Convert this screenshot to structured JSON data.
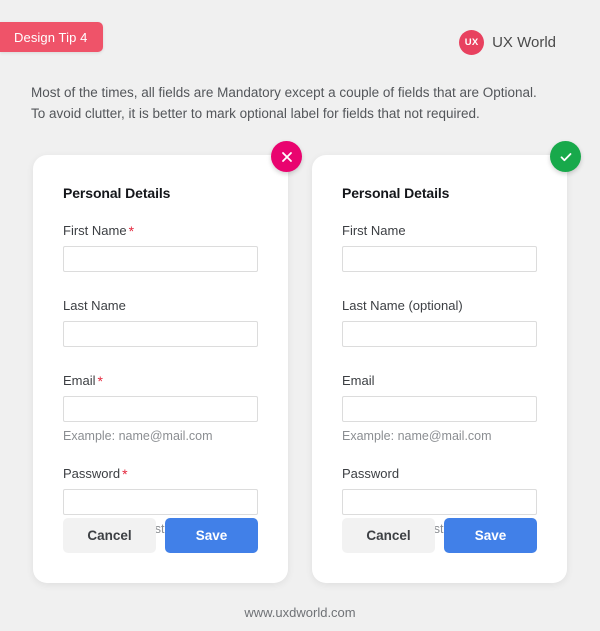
{
  "header": {
    "tip_badge": "Design Tip 4",
    "brand_mark": "UX",
    "brand_name": "UX World"
  },
  "intro": {
    "line1": "Most of the times, all fields are Mandatory except a couple of fields that are Optional.",
    "line2": "To avoid clutter, it is better to mark optional label for fields that not required."
  },
  "colors": {
    "background": "#f0f0f0",
    "tip_badge": "#ef5369",
    "brand_mark": "#e8415f",
    "bad_badge": "#e9046f",
    "good_badge": "#18a94b",
    "required_asterisk": "#e4273d",
    "save_button": "#4180e8",
    "cancel_button": "#f2f2f2",
    "card_background": "#ffffff",
    "input_border": "#dcdcdc"
  },
  "cards": [
    {
      "variant": "bad",
      "badge_icon": "close-icon",
      "title": "Personal Details",
      "fields": [
        {
          "label": "First Name",
          "required": true,
          "asterisk": "*",
          "hint": ""
        },
        {
          "label": "Last Name",
          "required": false,
          "asterisk": "",
          "hint": ""
        },
        {
          "label": "Email",
          "required": true,
          "asterisk": "*",
          "hint": "Example: name@mail.com"
        },
        {
          "label": "Password",
          "required": true,
          "asterisk": "*",
          "hint": "Must have at least 6 characters"
        }
      ],
      "cancel_label": "Cancel",
      "save_label": "Save"
    },
    {
      "variant": "good",
      "badge_icon": "check-icon",
      "title": "Personal Details",
      "fields": [
        {
          "label": "First Name",
          "required": false,
          "asterisk": "",
          "hint": ""
        },
        {
          "label": "Last Name (optional)",
          "required": false,
          "asterisk": "",
          "hint": ""
        },
        {
          "label": "Email",
          "required": false,
          "asterisk": "",
          "hint": "Example: name@mail.com"
        },
        {
          "label": "Password",
          "required": false,
          "asterisk": "",
          "hint": "Must have at least 6 characters"
        }
      ],
      "cancel_label": "Cancel",
      "save_label": "Save"
    }
  ],
  "footer": {
    "url": "www.uxdworld.com"
  }
}
